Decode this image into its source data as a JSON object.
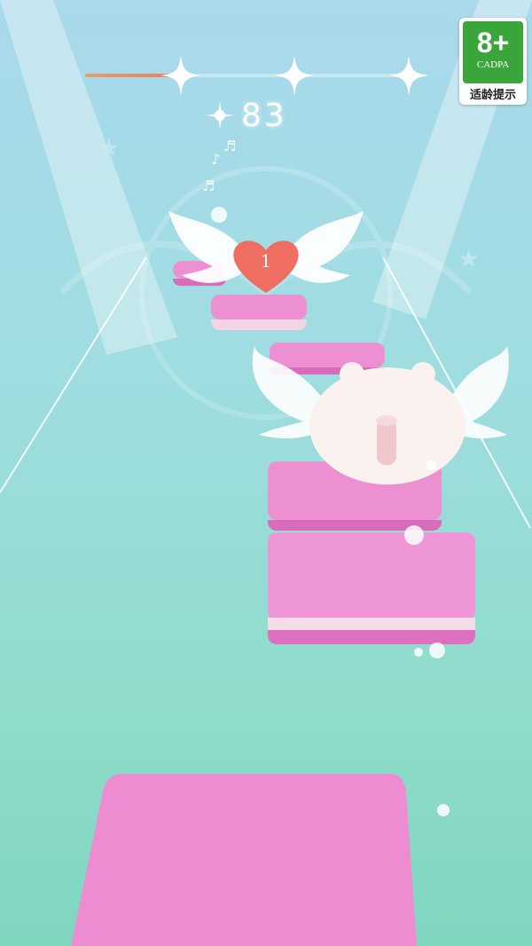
{
  "game": {
    "score": "83",
    "progress_fraction": 0.26,
    "milestones": [
      "star-1",
      "star-2",
      "star-3"
    ],
    "heart_count": "1"
  },
  "age_badge": {
    "rating": "8+",
    "org": "CADPA",
    "hint": "适龄提示",
    "color": "#3aa53a"
  },
  "colors": {
    "tile_top": "#ec90d2",
    "tile_side": "#d86cba",
    "heart": "#ee6f61",
    "progress": "#e8825e"
  }
}
